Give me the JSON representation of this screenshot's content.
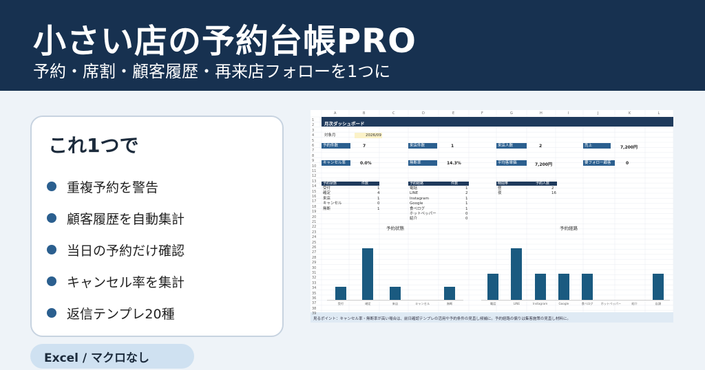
{
  "header": {
    "title": "小さい店の予約台帳PRO",
    "subtitle": "予約・席割・顧客履歴・再来店フォローを1つに"
  },
  "card": {
    "title": "これ1つで",
    "features": [
      "重複予約を警告",
      "顧客履歴を自動集計",
      "当日の予約だけ確認",
      "キャンセル率を集計",
      "返信テンプレ20種"
    ]
  },
  "pill": {
    "label": "Excel / マクロなし"
  },
  "colors": {
    "header_bg": "#173150",
    "accent": "#2b5f8f",
    "bar": "#1a5a80",
    "pill_bg": "#cfe1f1"
  },
  "sheet": {
    "columns": [
      "A",
      "B",
      "C",
      "D",
      "E",
      "F",
      "G",
      "H",
      "I",
      "J",
      "K",
      "L"
    ],
    "rows": [
      "1",
      "2",
      "3",
      "4",
      "5",
      "6",
      "7",
      "8",
      "9",
      "10",
      "11",
      "12",
      "13",
      "14",
      "15",
      "16",
      "17",
      "18",
      "19",
      "20",
      "21",
      "22",
      "23",
      "24",
      "25",
      "26",
      "27",
      "28",
      "29",
      "30",
      "31",
      "32",
      "33",
      "34",
      "35",
      "36",
      "37",
      "38",
      "39"
    ],
    "band_title": "月次ダッシュボード",
    "target_month_label": "対象月",
    "target_month_value": "2026/09",
    "kpis": [
      {
        "label": "予約件数",
        "value": "7"
      },
      {
        "label": "来店件数",
        "value": "1"
      },
      {
        "label": "来店人数",
        "value": "2"
      },
      {
        "label": "売上",
        "value": "7,200円"
      },
      {
        "label": "キャンセル率",
        "value": "0.0%"
      },
      {
        "label": "無断率",
        "value": "14.3%"
      },
      {
        "label": "平均客単価",
        "value": "7,200円"
      },
      {
        "label": "要フォロー顧客",
        "value": "0"
      }
    ],
    "table_status": {
      "headers": [
        "予約状態",
        "件数"
      ],
      "rows": [
        [
          "受付",
          "1"
        ],
        [
          "確定",
          "4"
        ],
        [
          "来店",
          "1"
        ],
        [
          "キャンセル",
          "0"
        ],
        [
          "無断",
          "1"
        ]
      ]
    },
    "table_route": {
      "headers": [
        "予約経路",
        "件数"
      ],
      "rows": [
        [
          "電話",
          "1"
        ],
        [
          "LINE",
          "2"
        ],
        [
          "Instagram",
          "1"
        ],
        [
          "Google",
          "1"
        ],
        [
          "食べログ",
          "1"
        ],
        [
          "ホットペッパー",
          "0"
        ],
        [
          "紹介",
          "0"
        ]
      ]
    },
    "table_time": {
      "headers": [
        "時間帯",
        "予約人数"
      ],
      "rows": [
        [
          "昼",
          "2"
        ],
        [
          "夜",
          "16"
        ]
      ]
    },
    "footer_note": "見るポイント：キャンセル率・無断率が高い場合は、前日確認テンプレの活用や予約条件の見直し候補に。予約経路の偏りは集客施策の見直し材料に。"
  },
  "chart_data": [
    {
      "type": "bar",
      "title": "予約状態",
      "categories": [
        "受付",
        "確定",
        "来店",
        "キャンセル",
        "無断"
      ],
      "values": [
        1,
        4,
        1,
        0,
        1
      ],
      "ylim": [
        0,
        5
      ]
    },
    {
      "type": "bar",
      "title": "予約経路",
      "categories": [
        "電話",
        "LINE",
        "Instagram",
        "Google",
        "食べログ",
        "ホットペッパー",
        "紹介",
        "店頭"
      ],
      "values": [
        1,
        2,
        1,
        1,
        1,
        0,
        0,
        1
      ],
      "ylim": [
        0,
        2.5
      ]
    }
  ]
}
